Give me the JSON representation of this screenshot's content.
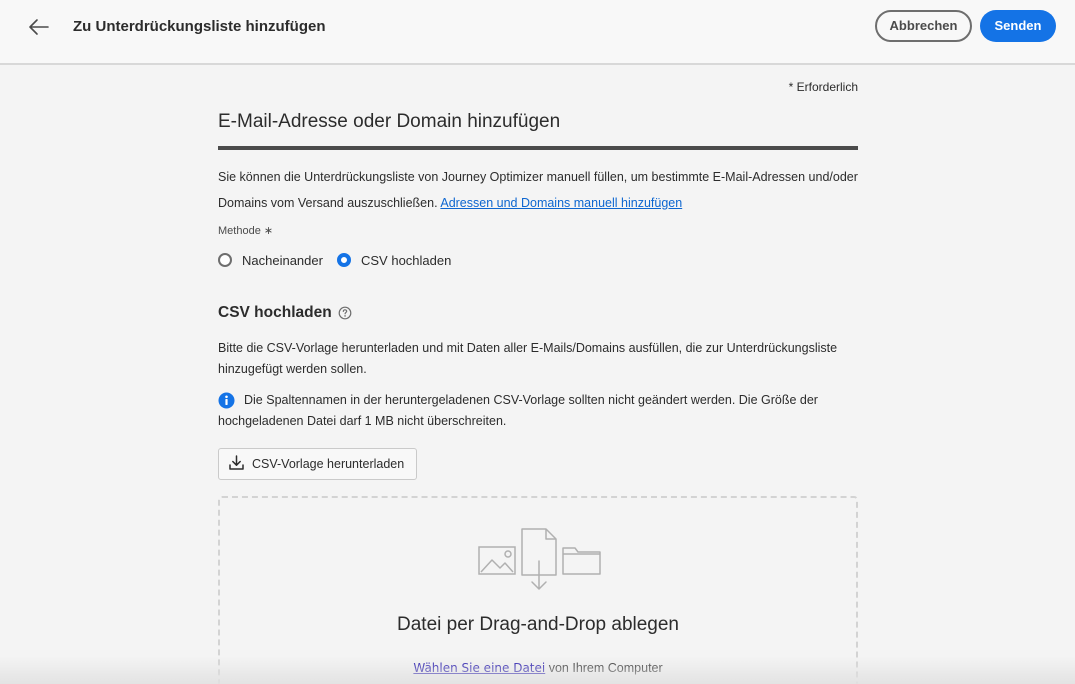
{
  "header": {
    "title": "Zu Unterdrückungsliste hinzufügen",
    "cancel_label": "Abbrechen",
    "send_label": "Senden"
  },
  "form": {
    "required_note": "* Erforderlich",
    "section_title": "E-Mail-Adresse oder Domain hinzufügen",
    "description": "Sie können die Unterdrückungsliste von Journey Optimizer manuell füllen, um bestimmte E-Mail-Adressen und/oder Domains vom Versand auszuschließen.",
    "description_link": "Adressen und Domains manuell hinzufügen",
    "method_label": "Methode",
    "method_required_mark": "∗",
    "method_options": [
      {
        "label": "Nacheinander",
        "selected": false
      },
      {
        "label": "CSV hochladen",
        "selected": true
      }
    ]
  },
  "csv": {
    "title": "CSV hochladen",
    "description": "Bitte die CSV-Vorlage herunterladen und mit Daten aller E-Mails/Domains ausfüllen, die zur Unterdrückungsliste hinzugefügt werden sollen.",
    "info": "Die Spaltennamen in der heruntergeladenen CSV-Vorlage sollten nicht geändert werden. Die Größe der hochgeladenen Datei darf 1 MB nicht überschreiten.",
    "download_label": "CSV-Vorlage herunterladen",
    "drop_title": "Datei per Drag-and-Drop ablegen",
    "choose_file_link": "Wählen Sie eine Datei",
    "choose_file_suffix": "von Ihrem Computer"
  },
  "colors": {
    "accent": "#1473e6",
    "link": "#0d66d0",
    "background": "#f4f4f4"
  },
  "icons": [
    "arrow-left-icon",
    "help-icon",
    "info-icon",
    "download-icon",
    "image-icon",
    "file-download-icon",
    "folder-icon"
  ]
}
